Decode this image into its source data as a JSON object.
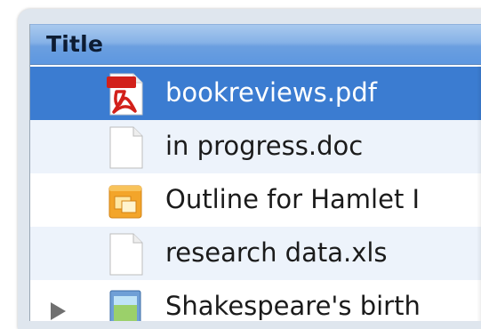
{
  "list": {
    "header": {
      "title": "Title"
    },
    "rows": [
      {
        "name": "bookreviews.pdf",
        "icon": "pdf-file-icon",
        "selected": true
      },
      {
        "name": "in progress.doc",
        "icon": "blank-document-icon",
        "selected": false
      },
      {
        "name": "Outline for Hamlet I",
        "icon": "outline-file-icon",
        "selected": false
      },
      {
        "name": "research data.xls",
        "icon": "blank-document-icon",
        "selected": false
      },
      {
        "name": "Shakespeare's birth",
        "icon": "image-file-icon",
        "selected": false,
        "folder": true
      }
    ]
  },
  "colors": {
    "selection": "#3b7cd1",
    "header": "#6b9fe0",
    "alternate_row": "#edf3fb"
  }
}
